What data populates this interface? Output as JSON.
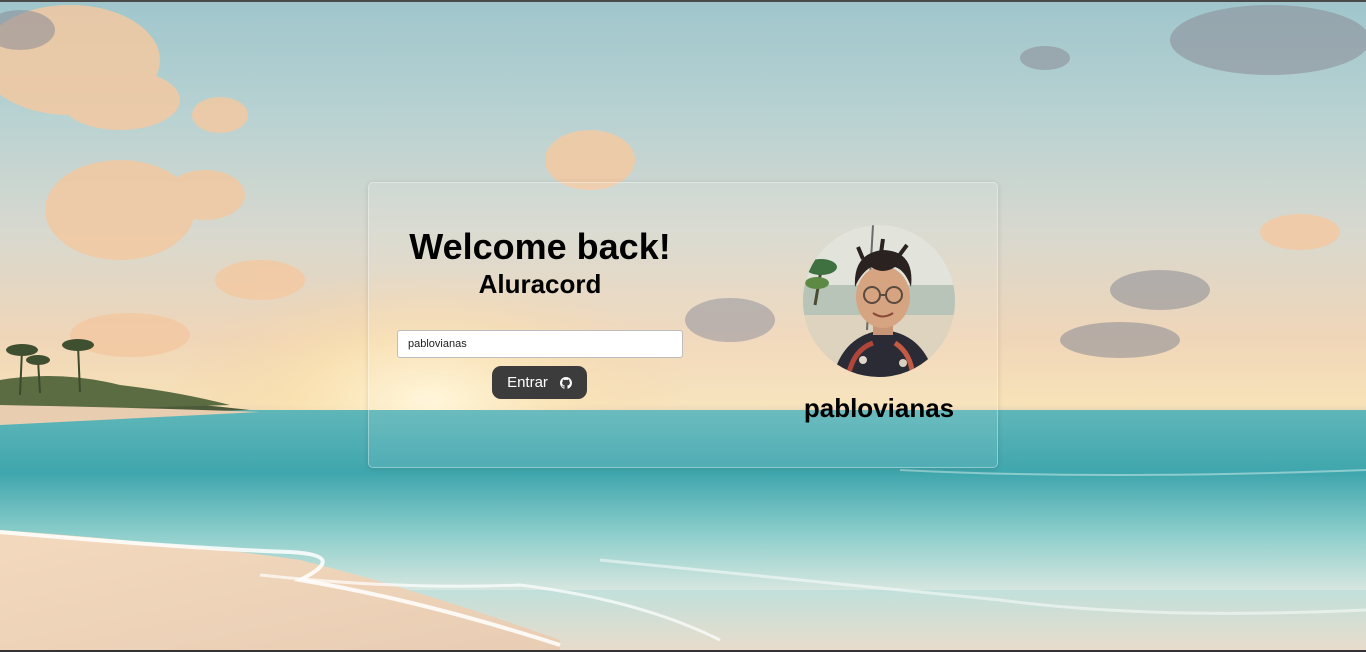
{
  "login": {
    "title": "Welcome back!",
    "subtitle": "Aluracord",
    "username_value": "pablovianas",
    "submit_label": "Entrar",
    "submit_icon": "github-icon"
  },
  "profile": {
    "username": "pablovianas",
    "avatar": "profile-photo"
  },
  "colors": {
    "button_bg": "#3c3c3c",
    "button_text": "#ffffff",
    "text": "#000000"
  }
}
